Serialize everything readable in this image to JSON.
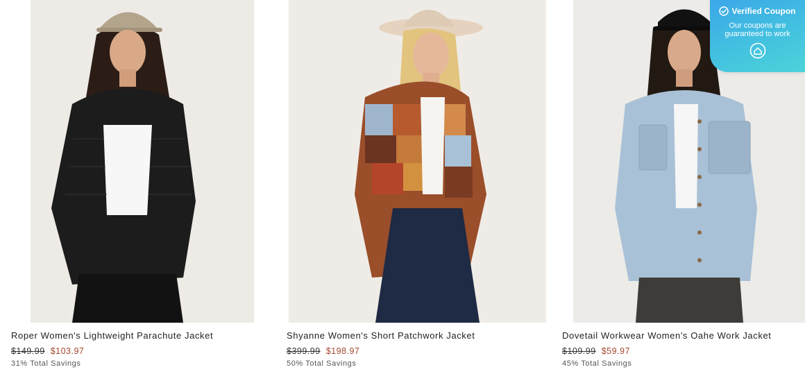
{
  "products": [
    {
      "title": "Roper Women's Lightweight Parachute Jacket",
      "original_price": "$149.99",
      "sale_price": "$103.97",
      "savings": "31% Total Savings",
      "jacket_color": "#1c1c1c"
    },
    {
      "title": "Shyanne Women's Short Patchwork Jacket",
      "original_price": "$399.99",
      "sale_price": "$198.97",
      "savings": "50% Total Savings",
      "jacket_color": "#9a4e2a"
    },
    {
      "title": "Dovetail Workwear Women's Oahe Work Jacket",
      "original_price": "$109.99",
      "sale_price": "$59.97",
      "savings": "45% Total Savings",
      "jacket_color": "#a9c1d6"
    }
  ],
  "coupon_badge": {
    "title": "Verified Coupon",
    "text": "Our coupons are guaranteed to work",
    "check_icon": "check-circle-icon",
    "logo_icon": "coupon-logo-icon"
  }
}
